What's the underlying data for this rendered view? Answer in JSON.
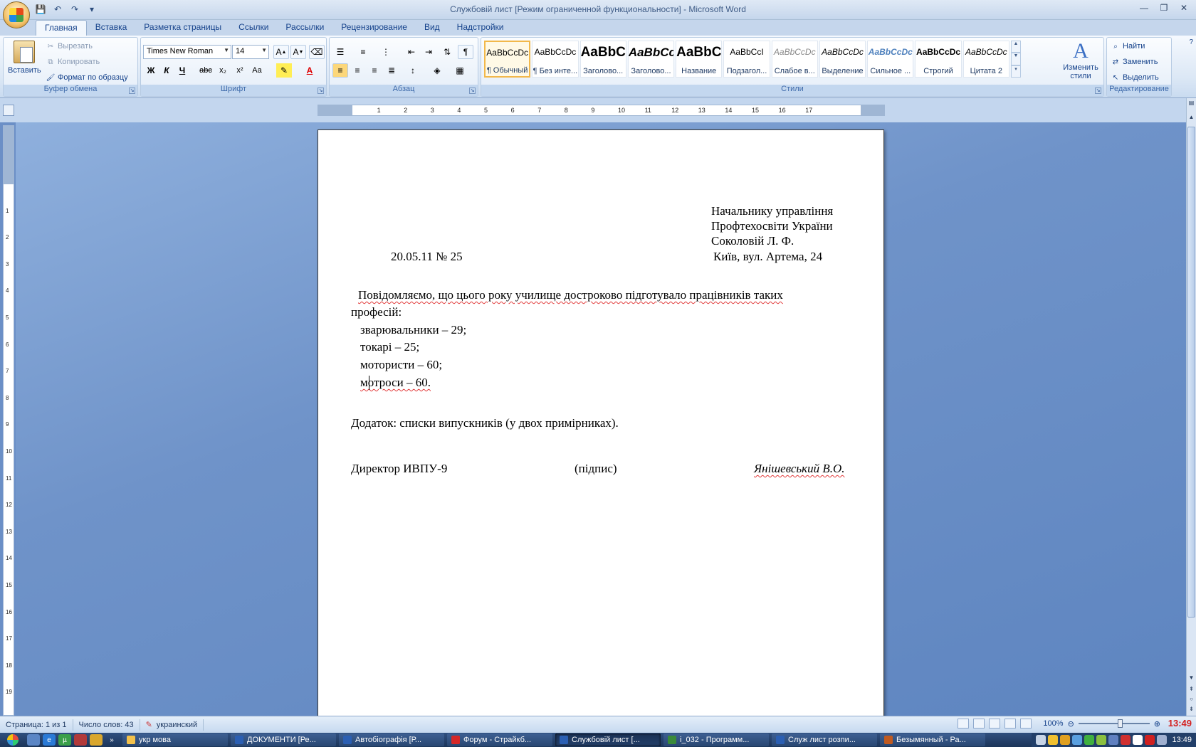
{
  "window": {
    "title": "Службовій лист [Режим ограниченной функциональности] - Microsoft Word"
  },
  "tabs": [
    "Главная",
    "Вставка",
    "Разметка страницы",
    "Ссылки",
    "Рассылки",
    "Рецензирование",
    "Вид",
    "Надстройки"
  ],
  "clipboard": {
    "label": "Буфер обмена",
    "paste": "Вставить",
    "cut": "Вырезать",
    "copy": "Копировать",
    "format_painter": "Формат по образцу"
  },
  "font": {
    "label": "Шрифт",
    "name": "Times New Roman",
    "size": "14",
    "bold": "Ж",
    "italic": "К",
    "underline": "Ч",
    "strike": "abc",
    "subscript": "x₂",
    "superscript": "x²",
    "case": "Aa"
  },
  "paragraph": {
    "label": "Абзац"
  },
  "styles": {
    "label": "Стили",
    "items": [
      {
        "sample": "AaBbCcDc",
        "name": "¶ Обычный"
      },
      {
        "sample": "AaBbCcDc",
        "name": "¶ Без инте..."
      },
      {
        "sample": "AaBbC",
        "name": "Заголово..."
      },
      {
        "sample": "AaBbCc",
        "name": "Заголово..."
      },
      {
        "sample": "AaBbC",
        "name": "Название"
      },
      {
        "sample": "AaBbCcI",
        "name": "Подзагол..."
      },
      {
        "sample": "AaBbCcDc",
        "name": "Слабое в..."
      },
      {
        "sample": "AaBbCcDc",
        "name": "Выделение"
      },
      {
        "sample": "AaBbCcDc",
        "name": "Сильное ..."
      },
      {
        "sample": "AaBbCcDc",
        "name": "Строгий"
      },
      {
        "sample": "AaBbCcDc",
        "name": "Цитата 2"
      }
    ],
    "change_styles": "Изменить стили"
  },
  "editing": {
    "label": "Редактирование",
    "find": "Найти",
    "replace": "Заменить",
    "select": "Выделить"
  },
  "document": {
    "addressee": [
      "Начальнику управління",
      "Профтехосвіти України",
      "Соколовій Л. Ф.",
      "Київ, вул. Артема, 24"
    ],
    "date_number": "20.05.11 № 25",
    "body_line1": "Повідомляємо, що цього року  училище достроково підготувало працівників таких",
    "body_line2": "професій:",
    "list": [
      "зварювальники – 29;",
      "токарі  –  25;",
      "мотористи – 60;",
      "мотроси – 60."
    ],
    "appendix": "Додаток: списки випускників (у двох примірниках).",
    "signature_left": "Директор ИВПУ-9",
    "signature_mid": "(підпис)",
    "signature_right": "Янішевський В.О."
  },
  "status": {
    "page": "Страница: 1 из 1",
    "words": "Число слов: 43",
    "language": "украинский",
    "zoom": "100%",
    "clock_overlay": "13:49"
  },
  "taskbar": {
    "items": [
      {
        "label": "укр мова",
        "color": "#f3c14b"
      },
      {
        "label": "ДОКУМЕНТИ [Ре...",
        "color": "#2b5fb3"
      },
      {
        "label": "Автобіографія [Р...",
        "color": "#2b5fb3"
      },
      {
        "label": "Форум - Страйкб...",
        "color": "#d62828"
      },
      {
        "label": "Службовій лист [...",
        "color": "#2b5fb3"
      },
      {
        "label": "i_032 - Программ...",
        "color": "#3a8a3a"
      },
      {
        "label": "Служ лист розпи...",
        "color": "#2b5fb3"
      },
      {
        "label": "Безымянный - Ра...",
        "color": "#c05a20"
      }
    ],
    "time": "13:49"
  }
}
